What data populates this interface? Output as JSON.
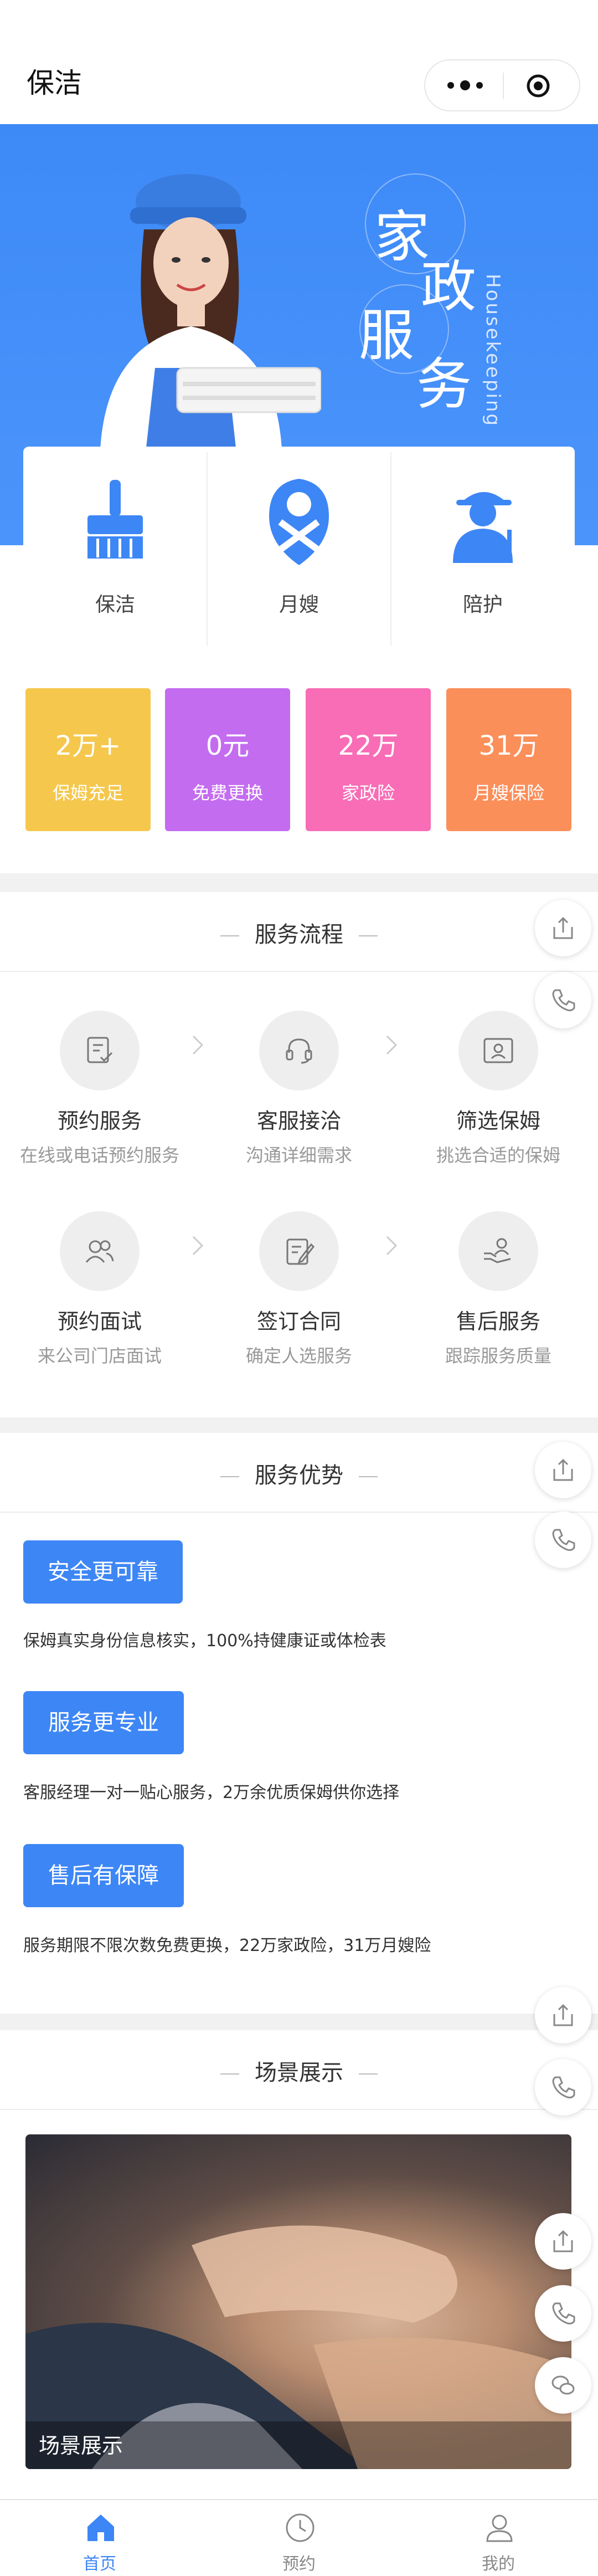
{
  "header": {
    "title": "保洁",
    "menu_icon": "more-dots-icon",
    "close_icon": "target-icon"
  },
  "hero": {
    "chars": [
      "家",
      "政",
      "服",
      "务"
    ],
    "english": "Housekeeping",
    "accent": "#4b94fb"
  },
  "categories": [
    {
      "label": "保洁",
      "icon": "cleaning-brush-icon"
    },
    {
      "label": "月嫂",
      "icon": "nanny-badge-icon"
    },
    {
      "label": "陪护",
      "icon": "caregiver-icon"
    }
  ],
  "stats": [
    {
      "value": "2万+",
      "label": "保姆充足",
      "color": "#f5c74c"
    },
    {
      "value": "0元",
      "label": "免费更换",
      "color": "#c46cf0"
    },
    {
      "value": "22万",
      "label": "家政险",
      "color": "#f86db6"
    },
    {
      "value": "31万",
      "label": "月嫂保险",
      "color": "#fb8f5a"
    }
  ],
  "process": {
    "title": "服务流程",
    "steps": [
      {
        "name": "预约服务",
        "desc": "在线或电话预约服务",
        "icon": "appointment-icon"
      },
      {
        "name": "客服接洽",
        "desc": "沟通详细需求",
        "icon": "headset-icon"
      },
      {
        "name": "筛选保姆",
        "desc": "挑选合适的保姆",
        "icon": "id-card-icon"
      },
      {
        "name": "预约面试",
        "desc": "来公司门店面试",
        "icon": "interview-icon"
      },
      {
        "name": "签订合同",
        "desc": "确定人选服务",
        "icon": "contract-icon"
      },
      {
        "name": "售后服务",
        "desc": "跟踪服务质量",
        "icon": "after-sales-icon"
      }
    ]
  },
  "advantages": {
    "title": "服务优势",
    "items": [
      {
        "button": "安全更可靠",
        "desc": "保姆真实身份信息核实，100%持健康证或体检表"
      },
      {
        "button": "服务更专业",
        "desc": "客服经理一对一贴心服务，2万余优质保姆供你选择"
      },
      {
        "button": "售后有保障",
        "desc": "服务期限不限次数免费更换，22万家政险，31万月嫂险"
      }
    ],
    "button_color": "#3d86f5"
  },
  "scenes": {
    "title": "场景展示",
    "caption": "场景展示"
  },
  "tabbar": {
    "active_color": "#3d86f5",
    "items": [
      {
        "label": "首页",
        "icon": "home-icon",
        "active": true
      },
      {
        "label": "预约",
        "icon": "clock-icon",
        "active": false
      },
      {
        "label": "我的",
        "icon": "user-icon",
        "active": false
      }
    ]
  }
}
